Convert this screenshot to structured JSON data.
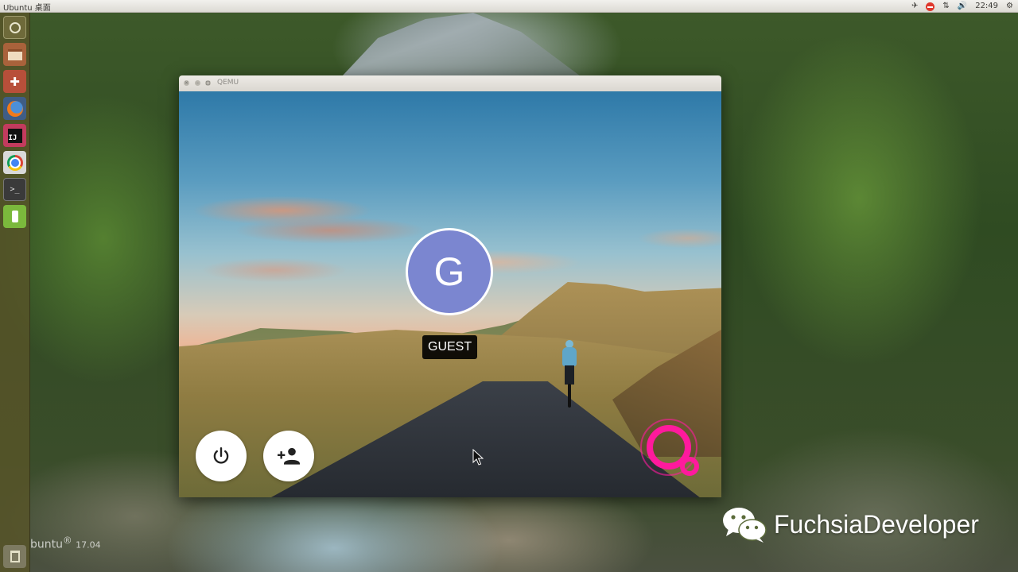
{
  "top_panel": {
    "title": "Ubuntu 桌面",
    "clock": "22:49"
  },
  "launcher": {
    "items": [
      {
        "name": "dash-home"
      },
      {
        "name": "files"
      },
      {
        "name": "system-settings"
      },
      {
        "name": "firefox"
      },
      {
        "name": "intellij-idea"
      },
      {
        "name": "chrome"
      },
      {
        "name": "terminal"
      },
      {
        "name": "android-device"
      },
      {
        "name": "trash"
      }
    ]
  },
  "desktop": {
    "os_watermark": "buntu",
    "os_registered": "®",
    "os_version": "17.04"
  },
  "qemu": {
    "title": "QEMU",
    "guest": {
      "avatar_initial": "G",
      "user_name": "GUEST",
      "avatar_color": "#7b86d0",
      "brand_color": "#ff1a9d"
    }
  },
  "watermark": {
    "text": "FuchsiaDeveloper"
  }
}
